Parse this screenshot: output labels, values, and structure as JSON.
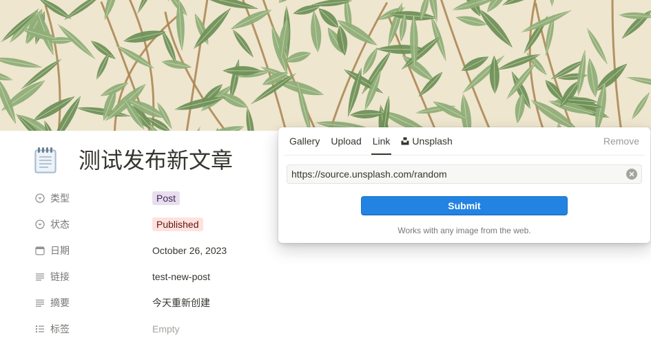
{
  "page": {
    "title": "测试发布新文章",
    "icon": "notepad-icon"
  },
  "properties": [
    {
      "label": "类型",
      "icon": "select-icon",
      "value": "Post",
      "kind": "tag",
      "color": "#e8deee"
    },
    {
      "label": "状态",
      "icon": "select-icon",
      "value": "Published",
      "kind": "tag",
      "color": "#ffe2dd"
    },
    {
      "label": "日期",
      "icon": "calendar-icon",
      "value": "October 26, 2023",
      "kind": "text"
    },
    {
      "label": "链接",
      "icon": "text-lines-icon",
      "value": "test-new-post",
      "kind": "text"
    },
    {
      "label": "摘要",
      "icon": "text-lines-icon",
      "value": "今天重新创建",
      "kind": "text"
    },
    {
      "label": "标签",
      "icon": "multi-select-icon",
      "value": "Empty",
      "kind": "empty"
    }
  ],
  "cover_popover": {
    "tabs": [
      {
        "label": "Gallery",
        "active": false
      },
      {
        "label": "Upload",
        "active": false
      },
      {
        "label": "Link",
        "active": true
      },
      {
        "label": "Unsplash",
        "active": false,
        "icon": "unsplash-icon"
      }
    ],
    "remove_label": "Remove",
    "url_value": "https://source.unsplash.com/random",
    "submit_label": "Submit",
    "hint": "Works with any image from the web."
  },
  "colors": {
    "accent": "#2383e2",
    "cover_background": "#efe6cf",
    "leaf": "#8fae78",
    "leaf_dark": "#6f9158",
    "stem": "#a8824f"
  }
}
